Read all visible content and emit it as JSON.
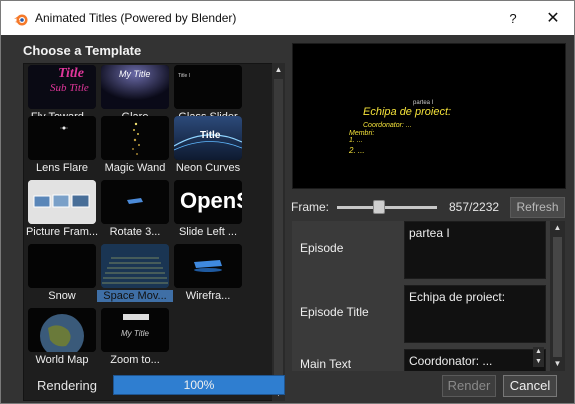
{
  "window": {
    "title": "Animated Titles (Powered by Blender)",
    "help_label": "?",
    "close_label": "✕"
  },
  "templates": {
    "heading": "Choose a Template",
    "items": [
      {
        "label": "Fly Toward...",
        "icon": "fly-toward-thumb"
      },
      {
        "label": "Glare",
        "icon": "glare-thumb"
      },
      {
        "label": "Glass Slider",
        "icon": "glass-slider-thumb"
      },
      {
        "label": "Lens Flare",
        "icon": "lens-flare-thumb"
      },
      {
        "label": "Magic Wand",
        "icon": "magic-wand-thumb"
      },
      {
        "label": "Neon Curves",
        "icon": "neon-curves-thumb"
      },
      {
        "label": "Picture Fram...",
        "icon": "picture-frame-thumb"
      },
      {
        "label": "Rotate 3...",
        "icon": "rotate-3d-thumb"
      },
      {
        "label": "Slide Left ...",
        "icon": "slide-left-thumb"
      },
      {
        "label": "Snow",
        "icon": "snow-thumb"
      },
      {
        "label": "Space Mov...",
        "icon": "space-movie-thumb",
        "selected": true
      },
      {
        "label": "Wirefra...",
        "icon": "wireframe-thumb"
      },
      {
        "label": "World Map",
        "icon": "world-map-thumb"
      },
      {
        "label": "Zoom to...",
        "icon": "zoom-to-thumb"
      }
    ],
    "thumb_text": {
      "title": "Title",
      "subtitle": "Sub Title",
      "my_title": "My Title",
      "title_small": "Title I",
      "neon": "Title",
      "opens": "OpenS",
      "zoom_title": "My Title"
    }
  },
  "preview": {
    "line1": "partea I",
    "line2": "Echipa de proiect:",
    "line3": "Coordonator: ...",
    "line4": "Membri:",
    "line5": "1.  ...",
    "line6": "2.  ..."
  },
  "frame": {
    "label": "Frame:",
    "current": 857,
    "total": 2232,
    "value_text": "857/2232",
    "refresh_label": "Refresh"
  },
  "properties": [
    {
      "label": "Episode",
      "value": "partea I"
    },
    {
      "label": "Episode Title",
      "value": "Echipa de proiect:"
    },
    {
      "label": "Main Text",
      "value": "Coordonator: ..."
    }
  ],
  "footer": {
    "rendering_label": "Rendering",
    "progress_percent": 100,
    "progress_text": "100%",
    "render_label": "Render",
    "cancel_label": "Cancel"
  },
  "colors": {
    "accent": "#2f7ed0",
    "preview_text": "#f4e23a",
    "background": "#333333"
  }
}
